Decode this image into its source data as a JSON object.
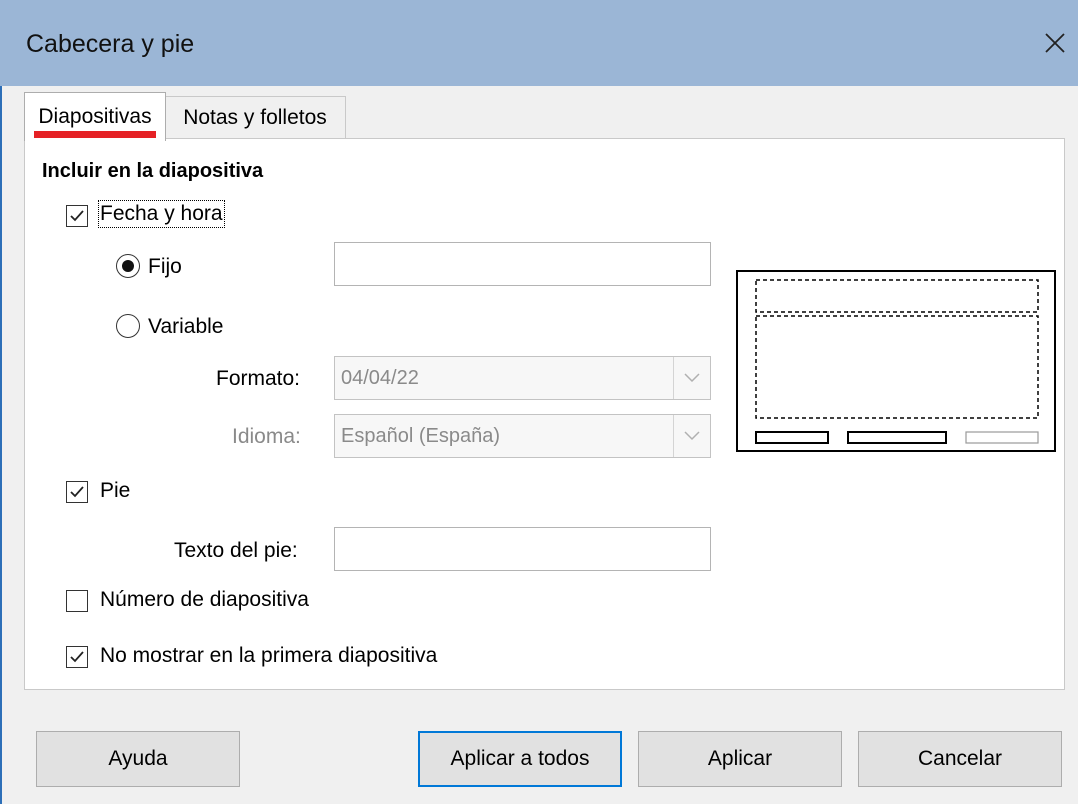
{
  "window": {
    "title": "Cabecera y pie",
    "close_icon": "close-icon"
  },
  "tabs": [
    {
      "label": "Diapositivas",
      "active": true
    },
    {
      "label": "Notas y folletos",
      "active": false
    }
  ],
  "accent_color": "#e52125",
  "section_heading": "Incluir en la diapositiva",
  "date_time": {
    "label": "Fecha y hora",
    "checked": true,
    "fixed": {
      "label": "Fijo",
      "selected": true,
      "value": ""
    },
    "variable": {
      "label": "Variable",
      "selected": false
    },
    "format": {
      "label": "Formato:",
      "value": "04/04/22"
    },
    "language": {
      "label": "Idioma:",
      "value": "Español (España)"
    }
  },
  "footer": {
    "label": "Pie",
    "checked": true,
    "text_label": "Texto del pie:",
    "text_value": ""
  },
  "slide_number": {
    "label": "Número de diapositiva",
    "checked": false
  },
  "hide_first": {
    "label": "No mostrar en la primera diapositiva",
    "checked": true
  },
  "buttons": {
    "help": "Ayuda",
    "apply_all": "Aplicar a todos",
    "apply": "Aplicar",
    "cancel": "Cancelar"
  }
}
